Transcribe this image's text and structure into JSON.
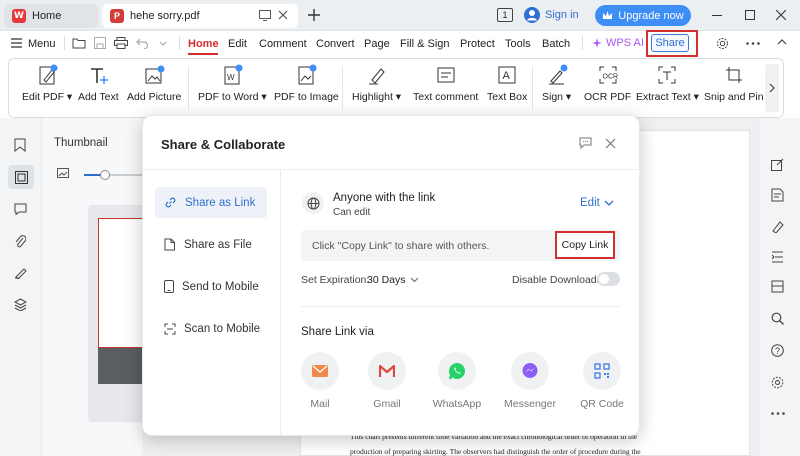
{
  "titlebar": {
    "home_tab": "Home",
    "doc_tab": "hehe sorry.pdf",
    "page_indicator": "1",
    "sign_in": "Sign in",
    "upgrade": "Upgrade now"
  },
  "menubar": {
    "menu_label": "Menu",
    "items": [
      "Home",
      "Edit",
      "Comment",
      "Convert",
      "Page",
      "Fill & Sign",
      "Protect",
      "Tools",
      "Batch"
    ],
    "wps_ai": "WPS AI",
    "share": "Share"
  },
  "ribbon": {
    "items": [
      {
        "label": "Edit PDF",
        "dropdown": true,
        "icon": "edit-pdf-icon"
      },
      {
        "label": "Add Text",
        "dropdown": false,
        "icon": "add-text-icon"
      },
      {
        "label": "Add Picture",
        "dropdown": false,
        "icon": "add-picture-icon"
      },
      {
        "label": "PDF to Word",
        "dropdown": true,
        "icon": "pdf-to-word-icon"
      },
      {
        "label": "PDF to Image",
        "dropdown": false,
        "icon": "pdf-to-image-icon"
      },
      {
        "label": "Highlight",
        "dropdown": true,
        "icon": "highlight-icon"
      },
      {
        "label": "Text comment",
        "dropdown": false,
        "icon": "text-comment-icon"
      },
      {
        "label": "Text Box",
        "dropdown": false,
        "icon": "text-box-icon"
      },
      {
        "label": "Sign",
        "dropdown": true,
        "icon": "sign-icon"
      },
      {
        "label": "OCR PDF",
        "dropdown": false,
        "icon": "ocr-icon"
      },
      {
        "label": "Extract Text",
        "dropdown": true,
        "icon": "extract-text-icon"
      },
      {
        "label": "Snip and Pin",
        "dropdown": false,
        "icon": "snip-icon"
      }
    ]
  },
  "thumbnail_panel": {
    "title": "Thumbnail"
  },
  "modal": {
    "title": "Share & Collaborate",
    "nav": [
      "Share as Link",
      "Share as File",
      "Send to Mobile",
      "Scan to Mobile"
    ],
    "access_title": "Anyone with the link",
    "access_sub": "Can edit",
    "access_mode": "Edit",
    "copy_hint": "Click \"Copy Link\" to share with others.",
    "copy_button": "Copy Link",
    "expiration_label": "Set Expiration:",
    "expiration_value": "30 Days",
    "disable_downloads": "Disable Downloads",
    "disable_downloads_on": false,
    "share_via_title": "Share Link via",
    "channels": [
      "Mail",
      "Gmail",
      "WhatsApp",
      "Messenger",
      "QR Code"
    ]
  },
  "document": {
    "line1": "This chart presents different time variation and the exact chronological order of operation in the",
    "line2": "production of preparing skirting. The observers had distinguish the order of procedure during the"
  },
  "colors": {
    "accent": "#2f6fcf",
    "brand_red": "#e33b3b",
    "upgrade_blue": "#3d8ef5",
    "highlight_red": "#d32f2f"
  }
}
